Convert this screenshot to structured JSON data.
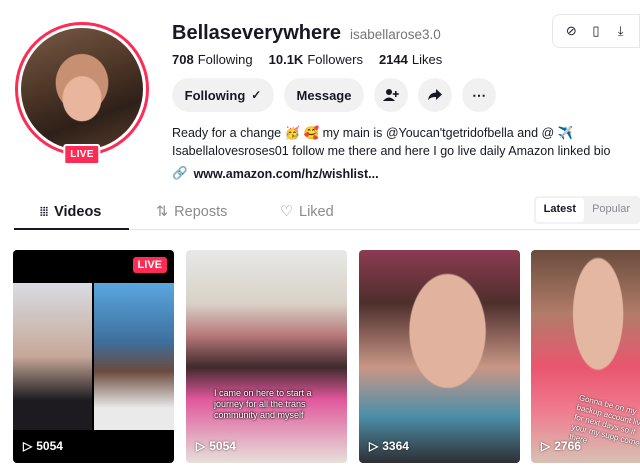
{
  "profile": {
    "display_name": "Bellaseverywhere",
    "username": "isabellarose3.0",
    "live_label": "LIVE",
    "stats": [
      {
        "value": "708",
        "label": "Following"
      },
      {
        "value": "10.1K",
        "label": "Followers"
      },
      {
        "value": "2144",
        "label": "Likes"
      }
    ],
    "bio_line1": "Ready for a change 🥳 🥰 my main is @Youcan'tgetridofbella and @ ✈️",
    "bio_line2": "Isabellalovesroses01 follow me there and here I go live daily Amazon linked bio",
    "link": "www.amazon.com/hz/wishlist..."
  },
  "actions": {
    "following_label": "Following",
    "message_label": "Message"
  },
  "tabs": [
    {
      "label": "Videos",
      "icon": "grid-icon"
    },
    {
      "label": "Reposts",
      "icon": "repost-icon"
    },
    {
      "label": "Liked",
      "icon": "heart-icon"
    }
  ],
  "sort": {
    "latest": "Latest",
    "popular": "Popular"
  },
  "videos": [
    {
      "views": "5054",
      "live": "LIVE",
      "caption": ""
    },
    {
      "views": "5054",
      "caption": "I came on here to start a journey for all the trans community and myself"
    },
    {
      "views": "3364",
      "caption": ""
    },
    {
      "views": "2766",
      "caption": "Gonna be on my backup account live for next days so if your my supp come there"
    }
  ]
}
